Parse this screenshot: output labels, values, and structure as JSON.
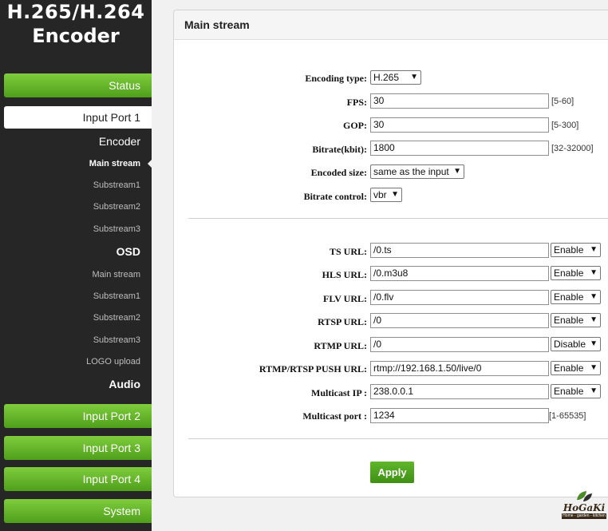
{
  "brand": {
    "line1": "H.265/H.264",
    "line2": "Encoder"
  },
  "sidebar": {
    "status": "Status",
    "input_port_1": "Input Port 1",
    "encoder": "Encoder",
    "encoder_items": [
      "Main stream",
      "Substream1",
      "Substream2",
      "Substream3"
    ],
    "osd": "OSD",
    "osd_items": [
      "Main stream",
      "Substream1",
      "Substream2",
      "Substream3",
      "LOGO upload"
    ],
    "audio": "Audio",
    "input_port_2": "Input Port 2",
    "input_port_3": "Input Port 3",
    "input_port_4": "Input Port 4",
    "system": "System",
    "active_item": "Main stream"
  },
  "panel": {
    "title": "Main stream",
    "encoding_type": {
      "label": "Encoding type:",
      "value": "H.265"
    },
    "fps": {
      "label": "FPS:",
      "value": "30",
      "hint": "[5-60]"
    },
    "gop": {
      "label": "GOP:",
      "value": "30",
      "hint": "[5-300]"
    },
    "bitrate": {
      "label": "Bitrate(kbit):",
      "value": "1800",
      "hint": "[32-32000]"
    },
    "encoded_size": {
      "label": "Encoded size:",
      "value": "same as the input"
    },
    "bitrate_control": {
      "label": "Bitrate control:",
      "value": "vbr"
    },
    "ts_url": {
      "label": "TS URL:",
      "value": "/0.ts",
      "state": "Enable"
    },
    "hls_url": {
      "label": "HLS URL:",
      "value": "/0.m3u8",
      "state": "Enable"
    },
    "flv_url": {
      "label": "FLV URL:",
      "value": "/0.flv",
      "state": "Enable"
    },
    "rtsp_url": {
      "label": "RTSP URL:",
      "value": "/0",
      "state": "Enable"
    },
    "rtmp_url": {
      "label": "RTMP URL:",
      "value": "/0",
      "state": "Disable"
    },
    "push_url": {
      "label": "RTMP/RTSP PUSH URL:",
      "value": "rtmp://192.168.1.50/live/0",
      "state": "Enable"
    },
    "multicast_ip": {
      "label": "Multicast IP :",
      "value": "238.0.0.1",
      "state": "Enable"
    },
    "multicast_port": {
      "label": "Multicast port :",
      "value": "1234",
      "hint": "[1-65535]"
    },
    "apply": "Apply"
  },
  "watermark": {
    "name": "HoGaKi",
    "tagline": "Home - garden - kitchen"
  },
  "colors": {
    "accent_green": "#5fb62a",
    "sidebar_bg": "#262626"
  }
}
